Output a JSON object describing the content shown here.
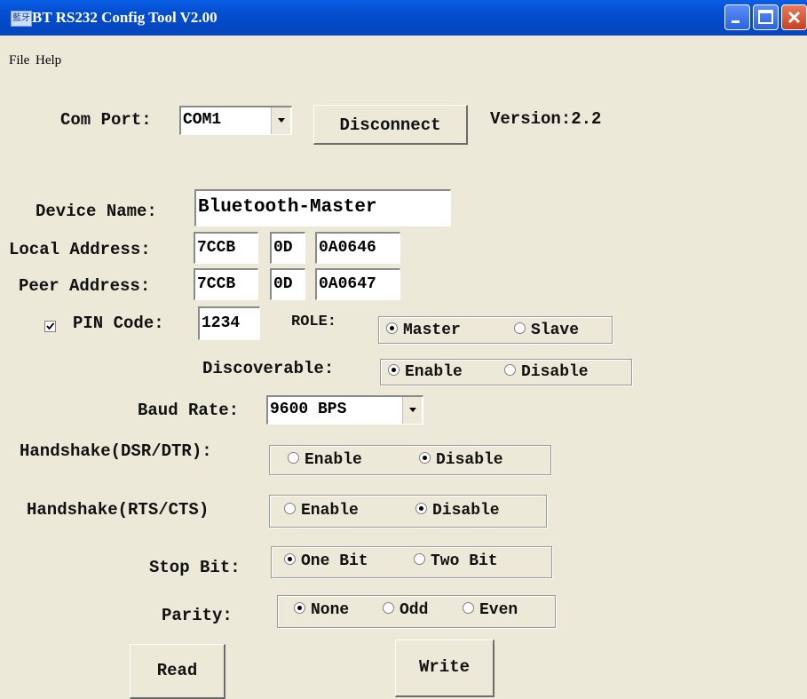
{
  "window": {
    "title": "BT RS232 Config Tool  V2.00",
    "app_icon_glyph": "藍牙"
  },
  "menu": {
    "file_label": "File",
    "help_label": "Help"
  },
  "connection": {
    "com_port_label": "Com Port:",
    "com_port_value": "COM1",
    "disconnect_label": "Disconnect",
    "version_label": "Version:2.2"
  },
  "device": {
    "name_label": "Device Name:",
    "name_value": "Bluetooth-Master",
    "local_label": "Local Address:",
    "local_nap": "7CCB",
    "local_uap": "0D",
    "local_lap": "0A0646",
    "peer_label": "Peer Address:",
    "peer_nap": "7CCB",
    "peer_uap": "0D",
    "peer_lap": "0A0647",
    "pin_label": "PIN Code:",
    "pin_checked": true,
    "pin_value": "1234"
  },
  "role": {
    "label": "ROLE:",
    "master": "Master",
    "slave": "Slave",
    "selected": "Master"
  },
  "discoverable": {
    "label": "Discoverable:",
    "enable": "Enable",
    "disable": "Disable",
    "selected": "Enable"
  },
  "baud": {
    "label": "Baud Rate:",
    "value": "9600 BPS"
  },
  "handshake_dsr": {
    "label": "Handshake(DSR/DTR):",
    "enable": "Enable",
    "disable": "Disable",
    "selected": "Disable"
  },
  "handshake_rts": {
    "label": "Handshake(RTS/CTS)",
    "enable": "Enable",
    "disable": "Disable",
    "selected": "Disable"
  },
  "stop_bit": {
    "label": "Stop Bit:",
    "one": "One Bit",
    "two": "Two Bit",
    "selected": "One Bit"
  },
  "parity": {
    "label": "Parity:",
    "none": "None",
    "odd": "Odd",
    "even": "Even",
    "selected": "None"
  },
  "actions": {
    "read_label": "Read",
    "write_label": "Write"
  },
  "icons": {
    "minimize": "minimize-icon",
    "maximize": "maximize-icon",
    "close": "close-icon",
    "combo_arrow": "chevron-down-icon",
    "check": "check-icon"
  }
}
